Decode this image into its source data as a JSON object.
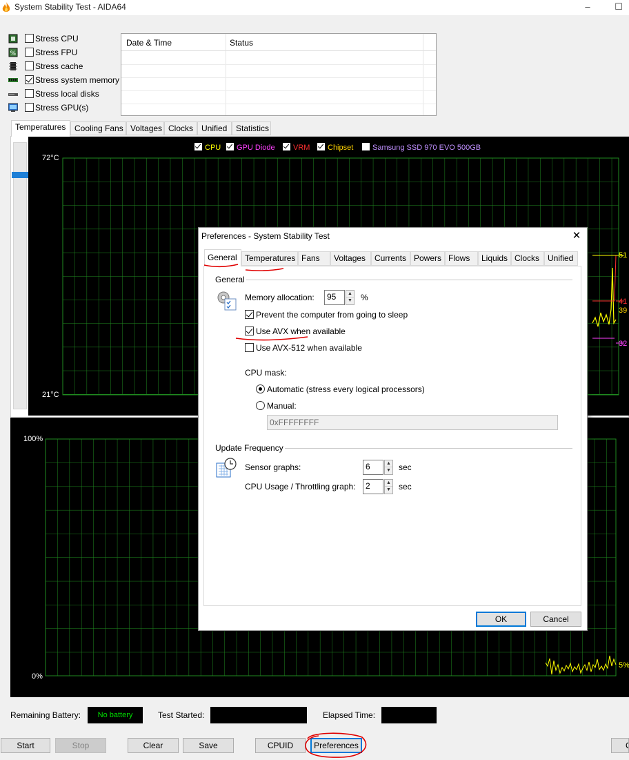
{
  "window": {
    "title": "System Stability Test - AIDA64"
  },
  "stress": [
    {
      "label": "Stress CPU",
      "checked": false,
      "icon": "cpu-icon"
    },
    {
      "label": "Stress FPU",
      "checked": false,
      "icon": "fpu-icon"
    },
    {
      "label": "Stress cache",
      "checked": false,
      "icon": "cache-icon"
    },
    {
      "label": "Stress system memory",
      "checked": true,
      "icon": "memory-icon"
    },
    {
      "label": "Stress local disks",
      "checked": false,
      "icon": "disk-icon"
    },
    {
      "label": "Stress GPU(s)",
      "checked": false,
      "icon": "gpu-icon"
    }
  ],
  "status_table": {
    "col_datetime": "Date & Time",
    "col_status": "Status"
  },
  "tabs": [
    "Temperatures",
    "Cooling Fans",
    "Voltages",
    "Clocks",
    "Unified",
    "Statistics"
  ],
  "temp_graph": {
    "legend": [
      {
        "label": "CPU",
        "color": "#ffff00",
        "checked": true
      },
      {
        "label": "GPU Diode",
        "color": "#ff40ff",
        "checked": true
      },
      {
        "label": "VRM",
        "color": "#ff3030",
        "checked": true
      },
      {
        "label": "Chipset",
        "color": "#ffd200",
        "checked": true
      },
      {
        "label": "Samsung SSD 970 EVO 500GB",
        "color": "#c090ff",
        "checked": false
      }
    ],
    "y_max_label": "72°C",
    "y_min_label": "21°C",
    "readouts": [
      {
        "value": "51",
        "color": "#ffff00"
      },
      {
        "value": "41",
        "color": "#ff3030"
      },
      {
        "value": "39",
        "color": "#ffd200"
      },
      {
        "value": "32",
        "color": "#ff40ff"
      }
    ]
  },
  "cpu_graph": {
    "y_max_label": "100%",
    "y_min_label": "0%",
    "readout": "5%"
  },
  "bottom": {
    "battery_label": "Remaining Battery:",
    "battery_value": "No battery",
    "test_started_label": "Test Started:",
    "elapsed_label": "Elapsed Time:"
  },
  "buttons": {
    "start": "Start",
    "stop": "Stop",
    "clear": "Clear",
    "save": "Save",
    "cpuid": "CPUID",
    "preferences": "Preferences",
    "close": "C"
  },
  "dialog": {
    "title": "Preferences - System Stability Test",
    "tabs": [
      "General",
      "Temperatures",
      "Fans",
      "Voltages",
      "Currents",
      "Powers",
      "Flows",
      "Liquids",
      "Clocks",
      "Unified"
    ],
    "general_group": "General",
    "memory_label": "Memory allocation:",
    "memory_value": "95",
    "memory_unit": "%",
    "prevent_sleep": "Prevent the computer from going to sleep",
    "use_avx": "Use AVX when available",
    "use_avx512": "Use AVX-512 when available",
    "cpu_mask_label": "CPU mask:",
    "automatic": "Automatic (stress every logical processors)",
    "manual": "Manual:",
    "mask_value": "0xFFFFFFFF",
    "update_group": "Update Frequency",
    "sensor_label": "Sensor graphs:",
    "sensor_value": "6",
    "sensor_unit": "sec",
    "cpu_graph_label": "CPU Usage / Throttling graph:",
    "cpu_graph_value": "2",
    "cpu_graph_unit": "sec",
    "ok": "OK",
    "cancel": "Cancel"
  }
}
